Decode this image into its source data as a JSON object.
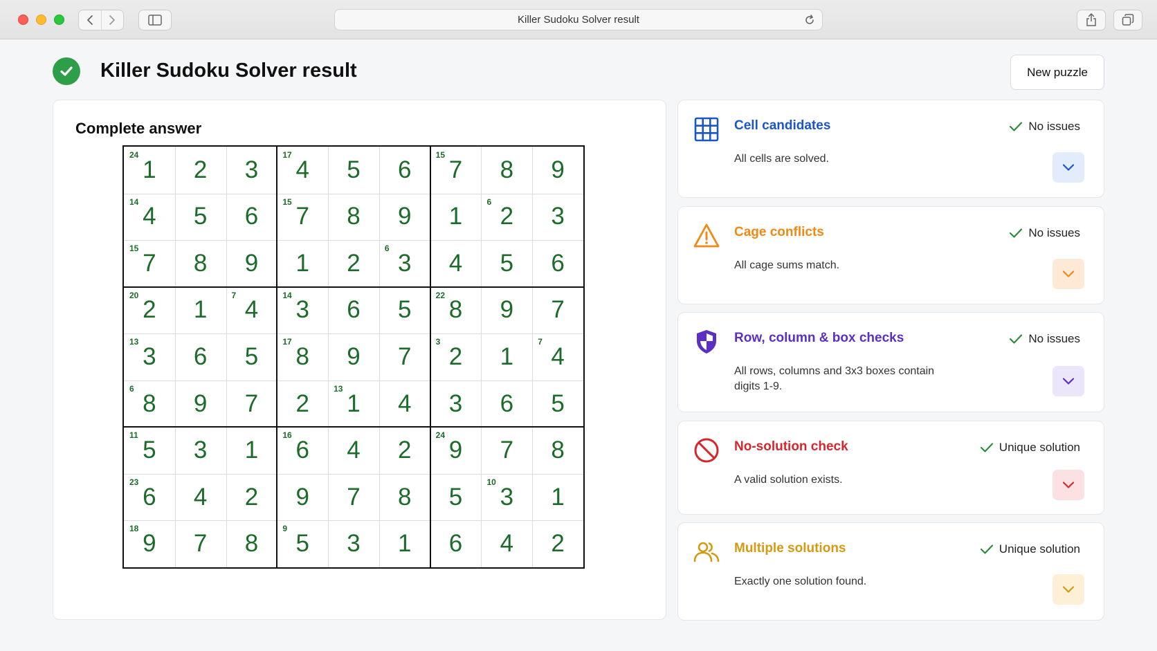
{
  "browser": {
    "url_title": "Killer Sudoku Solver result"
  },
  "header": {
    "title": "Killer Sudoku Solver result",
    "new_puzzle_label": "New puzzle"
  },
  "answer": {
    "title": "Complete answer",
    "grid": [
      [
        1,
        2,
        3,
        4,
        5,
        6,
        7,
        8,
        9
      ],
      [
        4,
        5,
        6,
        7,
        8,
        9,
        1,
        2,
        3
      ],
      [
        7,
        8,
        9,
        1,
        2,
        3,
        4,
        5,
        6
      ],
      [
        2,
        1,
        4,
        3,
        6,
        5,
        8,
        9,
        7
      ],
      [
        3,
        6,
        5,
        8,
        9,
        7,
        2,
        1,
        4
      ],
      [
        8,
        9,
        7,
        2,
        1,
        4,
        3,
        6,
        5
      ],
      [
        5,
        3,
        1,
        6,
        4,
        2,
        9,
        7,
        8
      ],
      [
        6,
        4,
        2,
        9,
        7,
        8,
        5,
        3,
        1
      ],
      [
        9,
        7,
        8,
        5,
        3,
        1,
        6,
        4,
        2
      ]
    ],
    "cage_sums": [
      {
        "row": 0,
        "col": 0,
        "sum": "24"
      },
      {
        "row": 0,
        "col": 3,
        "sum": "17"
      },
      {
        "row": 0,
        "col": 6,
        "sum": "15"
      },
      {
        "row": 1,
        "col": 0,
        "sum": "14"
      },
      {
        "row": 1,
        "col": 3,
        "sum": "15"
      },
      {
        "row": 1,
        "col": 7,
        "sum": "6"
      },
      {
        "row": 2,
        "col": 0,
        "sum": "15"
      },
      {
        "row": 2,
        "col": 5,
        "sum": "6"
      },
      {
        "row": 3,
        "col": 0,
        "sum": "20"
      },
      {
        "row": 3,
        "col": 2,
        "sum": "7"
      },
      {
        "row": 3,
        "col": 3,
        "sum": "14"
      },
      {
        "row": 3,
        "col": 6,
        "sum": "22"
      },
      {
        "row": 4,
        "col": 0,
        "sum": "13"
      },
      {
        "row": 4,
        "col": 3,
        "sum": "17"
      },
      {
        "row": 4,
        "col": 6,
        "sum": "3"
      },
      {
        "row": 4,
        "col": 8,
        "sum": "7"
      },
      {
        "row": 5,
        "col": 0,
        "sum": "6"
      },
      {
        "row": 5,
        "col": 4,
        "sum": "13"
      },
      {
        "row": 6,
        "col": 0,
        "sum": "11"
      },
      {
        "row": 6,
        "col": 3,
        "sum": "16"
      },
      {
        "row": 6,
        "col": 6,
        "sum": "24"
      },
      {
        "row": 7,
        "col": 0,
        "sum": "23"
      },
      {
        "row": 7,
        "col": 7,
        "sum": "10"
      },
      {
        "row": 8,
        "col": 0,
        "sum": "18"
      },
      {
        "row": 8,
        "col": 3,
        "sum": "9"
      }
    ]
  },
  "checks": [
    {
      "title": "Cell candidates",
      "status": "No issues",
      "desc": "All cells are solved.",
      "color": "#1a56c8",
      "button_bg": "#e3ecfb",
      "icon": "grid-icon"
    },
    {
      "title": "Cage conflicts",
      "status": "No issues",
      "desc": "All cage sums match.",
      "color": "#f08a12",
      "button_bg": "#fde9d6",
      "icon": "warning-icon"
    },
    {
      "title": "Row, column & box checks",
      "status": "No issues",
      "desc": "All rows, columns and 3x3 boxes contain digits 1-9.",
      "color": "#5b2fc4",
      "button_bg": "#ece6fa",
      "icon": "shield-icon"
    },
    {
      "title": "No-solution check",
      "status": "Unique solution",
      "desc": "A valid solution exists.",
      "color": "#d8262c",
      "button_bg": "#fbe1e2",
      "icon": "prohibited-icon"
    },
    {
      "title": "Multiple solutions",
      "status": "Unique solution",
      "desc": "Exactly one solution found.",
      "color": "#d49a12",
      "button_bg": "#fdf0d6",
      "icon": "users-icon"
    }
  ],
  "colors": {
    "success": "#2e9e49",
    "digit": "#1d6b2a",
    "check_mark": "#2e8b3e"
  }
}
